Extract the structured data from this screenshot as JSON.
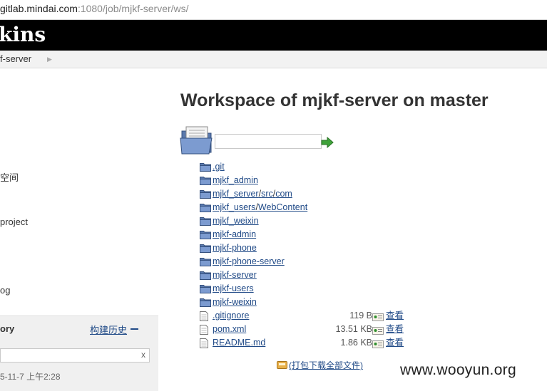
{
  "browser": {
    "url_host": "gitlab.mindai.com",
    "url_path": ":1080/job/mjkf-server/ws/"
  },
  "header": {
    "logo_text": "kins"
  },
  "breadcrumb": {
    "item": "f-server"
  },
  "sidebar": {
    "links": [
      {
        "label": "空间"
      },
      {
        "label": "project"
      },
      {
        "label": "og"
      }
    ],
    "history": {
      "title": "ory",
      "trend_link": "构建历史",
      "filter_clear": "x",
      "build_date": "5-11-7 上午2:28"
    }
  },
  "main": {
    "title": "Workspace of mjkf-server on master",
    "entries": [
      {
        "type": "folder",
        "parts": [
          ".git"
        ]
      },
      {
        "type": "folder",
        "parts": [
          "mjkf_admin"
        ]
      },
      {
        "type": "folder",
        "parts": [
          "mjkf_server",
          "/",
          "src",
          "/",
          "com"
        ]
      },
      {
        "type": "folder",
        "parts": [
          "mjkf_users",
          "/",
          "WebContent"
        ]
      },
      {
        "type": "folder",
        "parts": [
          "mjkf_weixin"
        ]
      },
      {
        "type": "folder",
        "parts": [
          "mjkf-admin"
        ]
      },
      {
        "type": "folder",
        "parts": [
          "mjkf-phone"
        ]
      },
      {
        "type": "folder",
        "parts": [
          "mjkf-phone-server"
        ]
      },
      {
        "type": "folder",
        "parts": [
          "mjkf-server"
        ]
      },
      {
        "type": "folder",
        "parts": [
          "mjkf-users"
        ]
      },
      {
        "type": "folder",
        "parts": [
          "mjkf-weixin"
        ]
      },
      {
        "type": "file",
        "parts": [
          ".gitignore"
        ],
        "size": "119 B",
        "view": "查看"
      },
      {
        "type": "file",
        "parts": [
          "pom.xml"
        ],
        "size": "13.51 KB",
        "view": "查看"
      },
      {
        "type": "file",
        "parts": [
          "README.md"
        ],
        "size": "1.86 KB",
        "view": "查看"
      }
    ],
    "zip_link": "(打包下载全部文件)"
  },
  "watermark": "www.wooyun.org",
  "icons": {
    "folder": "folder-icon",
    "file": "file-icon",
    "fingerprint": "fingerprint-icon",
    "go": "go-arrow-icon",
    "zip": "zip-package-icon"
  },
  "colors": {
    "link": "#204a87",
    "header": "#000000",
    "folder_blue": "#6f8fc4"
  }
}
